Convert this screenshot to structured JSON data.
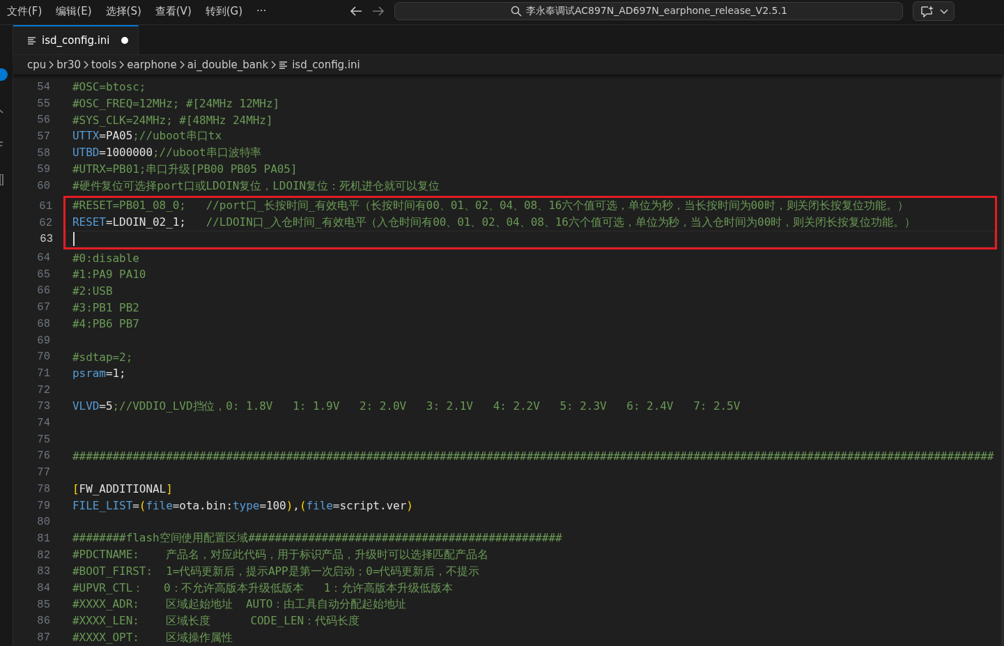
{
  "menu_bar": [
    {
      "label": "文件(F)"
    },
    {
      "label": "编辑(E)"
    },
    {
      "label": "选择(S)"
    },
    {
      "label": "查看(V)"
    },
    {
      "label": "转到(G)"
    },
    {
      "label": "···"
    }
  ],
  "command_center": {
    "value": "李永奉调试AC897N_AD697N_earphone_release_V2.5.1"
  },
  "tabs": [
    {
      "label": "isd_config.ini",
      "selected": true,
      "modified": true
    }
  ],
  "breadcrumbs": [
    {
      "label": "cpu"
    },
    {
      "label": "br30"
    },
    {
      "label": "tools"
    },
    {
      "label": "earphone"
    },
    {
      "label": "ai_double_bank"
    },
    {
      "label": "isd_config.ini",
      "kind": "file"
    }
  ],
  "editor": {
    "lines": [
      {
        "number": "54",
        "current": false,
        "boxed": false,
        "tokens": [
          {
            "kind": "comment",
            "text": "#OSC=btosc;"
          }
        ]
      },
      {
        "number": "55",
        "current": false,
        "boxed": false,
        "tokens": [
          {
            "kind": "comment",
            "text": "#OSC_FREQ=12MHz; #[24MHz 12MHz]"
          }
        ]
      },
      {
        "number": "56",
        "current": false,
        "boxed": false,
        "tokens": [
          {
            "kind": "comment",
            "text": "#SYS_CLK=24MHz; #[48MHz 24MHz]"
          }
        ]
      },
      {
        "number": "57",
        "current": false,
        "boxed": false,
        "tokens": [
          {
            "kind": "key",
            "text": "UTTX"
          },
          {
            "kind": "value",
            "text": "=PA05"
          },
          {
            "kind": "comment",
            "text": ";//uboot串口tx"
          }
        ]
      },
      {
        "number": "58",
        "current": false,
        "boxed": false,
        "tokens": [
          {
            "kind": "key",
            "text": "UTBD"
          },
          {
            "kind": "value",
            "text": "=1000000"
          },
          {
            "kind": "comment",
            "text": ";//uboot串口波特率"
          }
        ]
      },
      {
        "number": "59",
        "current": false,
        "boxed": false,
        "tokens": [
          {
            "kind": "comment",
            "text": "#UTRX=PB01;串口升级[PB00 PB05 PA05]"
          }
        ]
      },
      {
        "number": "60",
        "current": false,
        "boxed": false,
        "tokens": [
          {
            "kind": "comment",
            "text": "#硬件复位可选择port口或LDOIN复位，LDOIN复位：死机进仓就可以复位"
          }
        ]
      },
      {
        "number": "61",
        "current": false,
        "boxed": true,
        "tokens": [
          {
            "kind": "comment",
            "text": "#RESET=PB01_08_0;   //port口_长按时间_有效电平（长按时间有00、01、02、04、08、16六个值可选，单位为秒，当长按时间为00时，则关闭长按复位功能。）"
          }
        ]
      },
      {
        "number": "62",
        "current": false,
        "boxed": true,
        "tokens": [
          {
            "kind": "key",
            "text": "RESET"
          },
          {
            "kind": "value",
            "text": "=LDOIN_02_1;"
          },
          {
            "kind": "comment",
            "text": "   //LDOIN口_入仓时间_有效电平（入仓时间有00、01、02、04、08、16六个值可选，单位为秒，当入仓时间为00时，则关闭长按复位功能。）"
          }
        ]
      },
      {
        "number": "63",
        "current": true,
        "boxed": true
      },
      {
        "number": "64",
        "current": false,
        "boxed": false,
        "tokens": [
          {
            "kind": "comment",
            "text": "#0:disable"
          }
        ]
      },
      {
        "number": "65",
        "current": false,
        "boxed": false,
        "tokens": [
          {
            "kind": "comment",
            "text": "#1:PA9 PA10"
          }
        ]
      },
      {
        "number": "66",
        "current": false,
        "boxed": false,
        "tokens": [
          {
            "kind": "comment",
            "text": "#2:USB"
          }
        ]
      },
      {
        "number": "67",
        "current": false,
        "boxed": false,
        "tokens": [
          {
            "kind": "comment",
            "text": "#3:PB1 PB2"
          }
        ]
      },
      {
        "number": "68",
        "current": false,
        "boxed": false,
        "tokens": [
          {
            "kind": "comment",
            "text": "#4:PB6 PB7"
          }
        ]
      },
      {
        "number": "69",
        "current": false,
        "boxed": false
      },
      {
        "number": "70",
        "current": false,
        "boxed": false,
        "tokens": [
          {
            "kind": "comment",
            "text": "#sdtap=2;"
          }
        ]
      },
      {
        "number": "71",
        "current": false,
        "boxed": false,
        "tokens": [
          {
            "kind": "key",
            "text": "psram"
          },
          {
            "kind": "value",
            "text": "=1;"
          }
        ]
      },
      {
        "number": "72",
        "current": false,
        "boxed": false
      },
      {
        "number": "73",
        "current": false,
        "boxed": false,
        "tokens": [
          {
            "kind": "key",
            "text": "VLVD"
          },
          {
            "kind": "value",
            "text": "=5"
          },
          {
            "kind": "comment",
            "text": ";//VDDIO_LVD挡位，0: 1.8V   1: 1.9V   2: 2.0V   3: 2.1V   4: 2.2V   5: 2.3V   6: 2.4V   7: 2.5V"
          }
        ]
      },
      {
        "number": "74",
        "current": false,
        "boxed": false
      },
      {
        "number": "75",
        "current": false,
        "boxed": false
      },
      {
        "number": "76",
        "current": false,
        "boxed": false,
        "tokens": [
          {
            "kind": "comment",
            "text": "##########################################################################################################################################"
          }
        ]
      },
      {
        "number": "77",
        "current": false,
        "boxed": false
      },
      {
        "number": "78",
        "current": false,
        "boxed": false,
        "tokens": [
          {
            "kind": "bracket",
            "text": "["
          },
          {
            "kind": "value",
            "text": "FW_ADDITIONAL"
          },
          {
            "kind": "bracket",
            "text": "]"
          }
        ]
      },
      {
        "number": "79",
        "current": false,
        "boxed": false,
        "tokens": [
          {
            "kind": "key",
            "text": "FILE_LIST"
          },
          {
            "kind": "value",
            "text": "="
          },
          {
            "kind": "bracket",
            "text": "("
          },
          {
            "kind": "key",
            "text": "file"
          },
          {
            "kind": "value",
            "text": "=ota.bin:"
          },
          {
            "kind": "key",
            "text": "type"
          },
          {
            "kind": "value",
            "text": "=100"
          },
          {
            "kind": "bracket",
            "text": ")"
          },
          {
            "kind": "value",
            "text": ","
          },
          {
            "kind": "bracket",
            "text": "("
          },
          {
            "kind": "key",
            "text": "file"
          },
          {
            "kind": "value",
            "text": "=script.ver"
          },
          {
            "kind": "bracket",
            "text": ")"
          }
        ]
      },
      {
        "number": "80",
        "current": false,
        "boxed": false
      },
      {
        "number": "81",
        "current": false,
        "boxed": false,
        "tokens": [
          {
            "kind": "comment",
            "text": "########flash空间使用配置区域###############################################"
          }
        ]
      },
      {
        "number": "82",
        "current": false,
        "boxed": false,
        "tokens": [
          {
            "kind": "comment",
            "text": "#PDCTNAME:    产品名，对应此代码，用于标识产品，升级时可以选择匹配产品名"
          }
        ]
      },
      {
        "number": "83",
        "current": false,
        "boxed": false,
        "tokens": [
          {
            "kind": "comment",
            "text": "#BOOT_FIRST:  1=代码更新后，提示APP是第一次启动；0=代码更新后，不提示"
          }
        ]
      },
      {
        "number": "84",
        "current": false,
        "boxed": false,
        "tokens": [
          {
            "kind": "comment",
            "text": "#UPVR_CTL：   0：不允许高版本升级低版本   1：允许高版本升级低版本"
          }
        ]
      },
      {
        "number": "85",
        "current": false,
        "boxed": false,
        "tokens": [
          {
            "kind": "comment",
            "text": "#XXXX_ADR:    区域起始地址  AUTO：由工具自动分配起始地址"
          }
        ]
      },
      {
        "number": "86",
        "current": false,
        "boxed": false,
        "tokens": [
          {
            "kind": "comment",
            "text": "#XXXX_LEN:    区域长度      CODE_LEN：代码长度"
          }
        ]
      },
      {
        "number": "87",
        "current": false,
        "boxed": false,
        "tokens": [
          {
            "kind": "comment",
            "text": "#XXXX_OPT:    区域操作属性"
          }
        ]
      }
    ]
  }
}
